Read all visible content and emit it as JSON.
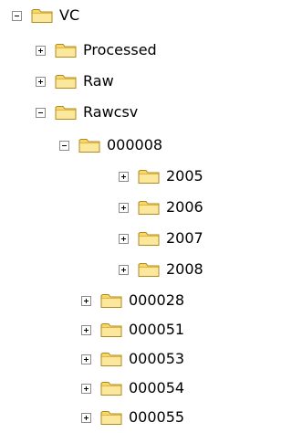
{
  "tree": {
    "root": {
      "label": "VC",
      "expander": "minus",
      "icon": "folder-icon"
    },
    "vc_children": [
      {
        "label": "Processed",
        "expander": "plus",
        "icon": "folder-icon"
      },
      {
        "label": "Raw",
        "expander": "plus",
        "icon": "folder-icon"
      },
      {
        "label": "Rawcsv",
        "expander": "minus",
        "icon": "folder-icon"
      }
    ],
    "rawcsv_children": [
      {
        "label": "000008",
        "expander": "minus",
        "icon": "folder-icon"
      },
      {
        "label": "000028",
        "expander": "plus",
        "icon": "folder-icon"
      },
      {
        "label": "000051",
        "expander": "plus",
        "icon": "folder-icon"
      },
      {
        "label": "000053",
        "expander": "plus",
        "icon": "folder-icon"
      },
      {
        "label": "000054",
        "expander": "plus",
        "icon": "folder-icon"
      },
      {
        "label": "000055",
        "expander": "plus",
        "icon": "folder-icon"
      }
    ],
    "folder_000008_children": [
      {
        "label": "2005",
        "expander": "plus",
        "icon": "folder-icon"
      },
      {
        "label": "2006",
        "expander": "plus",
        "icon": "folder-icon"
      },
      {
        "label": "2007",
        "expander": "plus",
        "icon": "folder-icon"
      },
      {
        "label": "2008",
        "expander": "plus",
        "icon": "folder-icon"
      }
    ]
  },
  "colors": {
    "folder_body": "#f7d76b",
    "folder_tab": "#fbe89c",
    "folder_outline": "#b08a1e",
    "expander_border": "#8c8c8c"
  }
}
